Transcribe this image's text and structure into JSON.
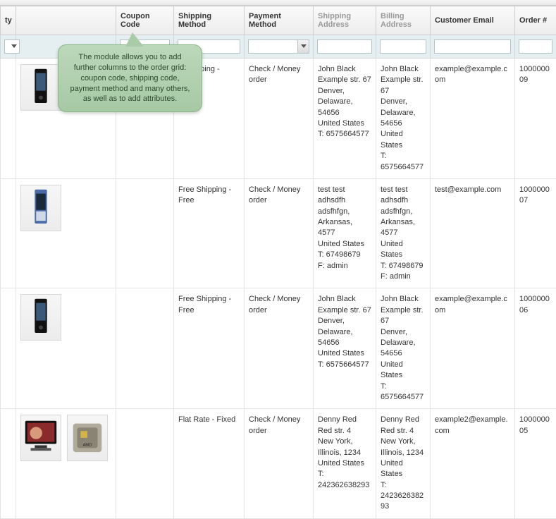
{
  "headers": {
    "qty": "ty",
    "thumb": "",
    "coupon": "Coupon Code",
    "shipping": "Shipping Method",
    "payment": "Payment Method",
    "shipaddr": "Shipping Address",
    "billaddr": "Billing Address",
    "email": "Customer Email",
    "order": "Order #"
  },
  "tooltip": "The module allows you to add further columns to the order grid: coupon code, shipping code, payment method and many others, as well as to add attributes.",
  "rows": [
    {
      "thumb_kind": "phone-dark",
      "coupon": "",
      "shipping_shown": "e Shipping -\ne",
      "payment": "Check / Money order",
      "shipaddr": "John Black\nExample str. 67\nDenver, Delaware, 54656\nUnited States\nT: 6575664577",
      "billaddr": "John Black\nExample str. 67\nDenver, Delaware, 54656\nUnited States\nT: 6575664577",
      "email": "example@example.com",
      "order": "100000009"
    },
    {
      "thumb_kind": "phone-light",
      "coupon": "",
      "shipping_shown": "Free Shipping - Free",
      "payment": "Check / Money order",
      "shipaddr": "test test\nadhsdfh adsfhfgn, Arkansas, 4577\nUnited States\nT: 67498679\nF: admin",
      "billaddr": "test test\nadhsdfh adsfhfgn, Arkansas, 4577\nUnited States\nT: 67498679\nF: admin",
      "email": "test@example.com",
      "order": "100000007"
    },
    {
      "thumb_kind": "phone-dark",
      "coupon": "",
      "shipping_shown": "Free Shipping - Free",
      "payment": "Check / Money order",
      "shipaddr": "John Black\nExample str. 67\nDenver, Delaware, 54656\nUnited States\nT: 6575664577",
      "billaddr": "John Black\nExample str. 67\nDenver, Delaware, 54656\nUnited States\nT: 6575664577",
      "email": "example@example.com",
      "order": "100000006"
    },
    {
      "thumb_kind": "monitor-cpu",
      "coupon": "",
      "shipping_shown": "Flat Rate - Fixed",
      "payment": "Check / Money order",
      "shipaddr": "Denny Red\nRed str. 4\nNew York, Illinois, 1234\nUnited States\nT: 242362638293",
      "billaddr": "Denny Red\nRed str. 4\nNew York, Illinois, 1234\nUnited States\nT: 242362638293",
      "email": "example2@example.com",
      "order": "100000005"
    }
  ]
}
